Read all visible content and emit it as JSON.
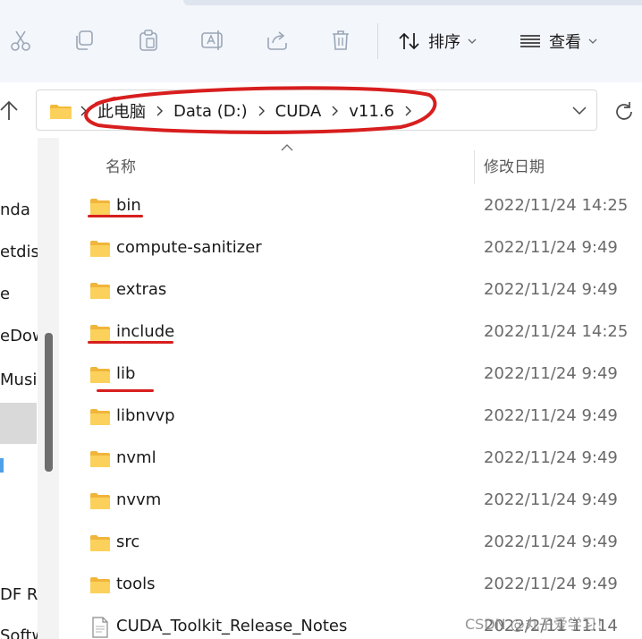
{
  "toolbar": {
    "icons": [
      "cut-icon",
      "copy-icon",
      "paste-icon",
      "rename-icon",
      "share-icon",
      "delete-icon"
    ],
    "sort_label": "排序",
    "view_label": "查看"
  },
  "address": {
    "crumbs": [
      "此电脑",
      "Data (D:)",
      "CUDA",
      "v11.6"
    ]
  },
  "sidebar": {
    "items": [
      "nda",
      "etdis",
      "e",
      "eDow",
      "Music",
      "DF Re",
      "Softw"
    ]
  },
  "columns": {
    "name": "名称",
    "modified": "修改日期"
  },
  "files": [
    {
      "name": "bin",
      "date": "2022/11/24 14:25",
      "type": "folder"
    },
    {
      "name": "compute-sanitizer",
      "date": "2022/11/24 9:49",
      "type": "folder"
    },
    {
      "name": "extras",
      "date": "2022/11/24 9:49",
      "type": "folder"
    },
    {
      "name": "include",
      "date": "2022/11/24 14:25",
      "type": "folder"
    },
    {
      "name": "lib",
      "date": "2022/11/24 9:49",
      "type": "folder"
    },
    {
      "name": "libnvvp",
      "date": "2022/11/24 9:49",
      "type": "folder"
    },
    {
      "name": "nvml",
      "date": "2022/11/24 9:49",
      "type": "folder"
    },
    {
      "name": "nvvm",
      "date": "2022/11/24 9:49",
      "type": "folder"
    },
    {
      "name": "src",
      "date": "2022/11/24 9:49",
      "type": "folder"
    },
    {
      "name": "tools",
      "date": "2022/11/24 9:49",
      "type": "folder"
    },
    {
      "name": "CUDA_Toolkit_Release_Notes",
      "date": "2022/2/11 11:14",
      "type": "file"
    }
  ],
  "watermark": "CSDN @丸子爱学习！",
  "colors": {
    "annotation_red": "#d81e1e",
    "folder_yellow": "#f8c548",
    "toolbar_bg": "#f3f6fb"
  }
}
